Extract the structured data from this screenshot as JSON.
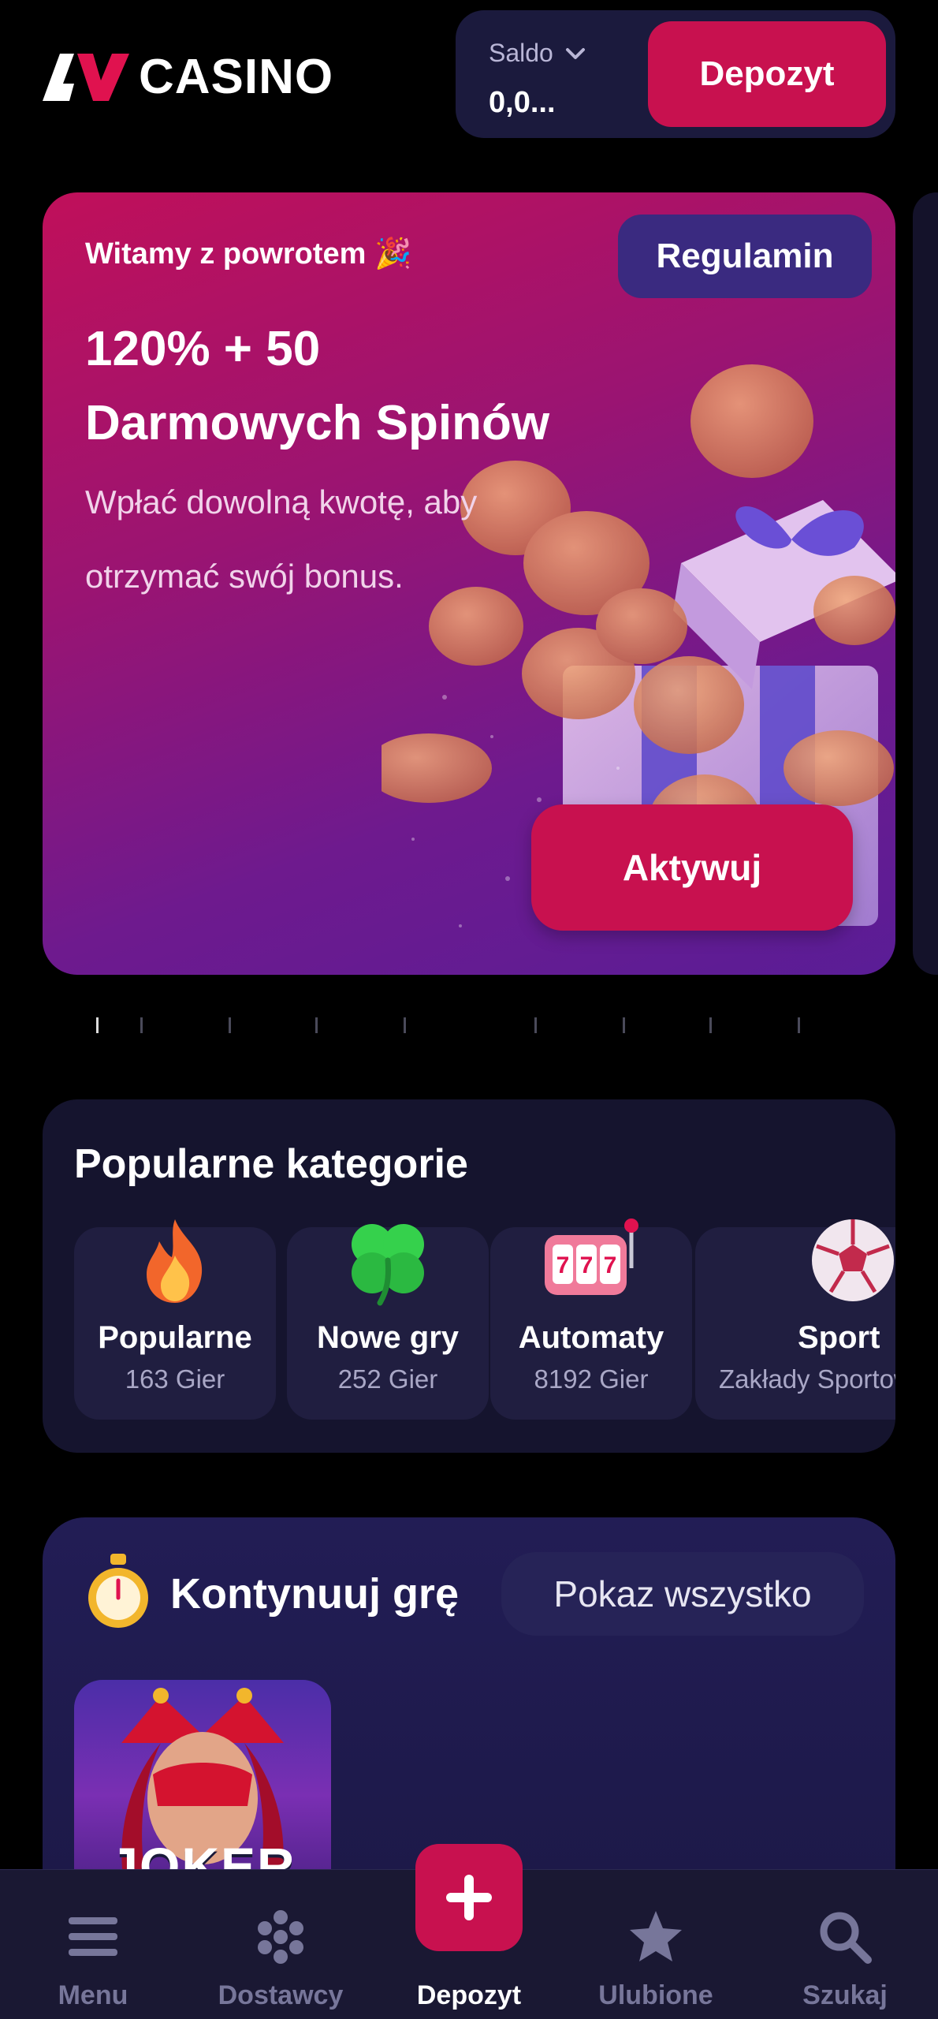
{
  "header": {
    "logo_text": "CASINO",
    "balance_label": "Saldo",
    "balance_value": "0,0...",
    "deposit_label": "Depozyt"
  },
  "promo": {
    "welcome": "Witamy z powrotem 🎉",
    "terms_label": "Regulamin",
    "title_line1": "120% + 50",
    "title_line2": "Darmowych Spinów",
    "subtitle": "Wpłać dowolną kwotę, aby otrzymać swój bonus.",
    "activate_label": "Aktywuj"
  },
  "carousel": {
    "slide_count": 9,
    "active_index": 0
  },
  "categories": {
    "title": "Popularne kategorie",
    "items": [
      {
        "name": "Popularne",
        "count": "163 Gier",
        "icon": "flame-icon"
      },
      {
        "name": "Nowe gry",
        "count": "252 Gier",
        "icon": "clover-icon"
      },
      {
        "name": "Automaty",
        "count": "8192 Gier",
        "icon": "slot-machine-icon"
      },
      {
        "name": "Sport",
        "count": "Zakłady Sportowe",
        "icon": "soccer-ball-icon"
      }
    ]
  },
  "continue": {
    "title": "Kontynuuj grę",
    "show_all_label": "Pokaz wszystko",
    "games": [
      {
        "title": "JOKER"
      }
    ]
  },
  "bottom_nav": {
    "items": [
      {
        "label": "Menu",
        "icon": "menu-icon"
      },
      {
        "label": "Dostawcy",
        "icon": "providers-icon"
      },
      {
        "label": "Depozyt",
        "icon": "plus-icon"
      },
      {
        "label": "Ulubione",
        "icon": "star-icon"
      },
      {
        "label": "Szukaj",
        "icon": "search-icon"
      }
    ]
  },
  "colors": {
    "accent": "#c8114f",
    "panel": "#15142e",
    "nav_bg": "#1a1833",
    "muted": "#77769a"
  }
}
